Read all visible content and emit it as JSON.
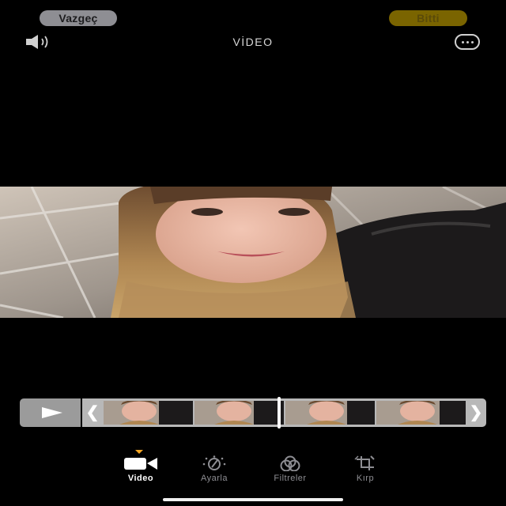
{
  "header": {
    "cancel_label": "Vazgeç",
    "done_label": "Bitti",
    "title": "VİDEO"
  },
  "icons": {
    "sound": "speaker-icon",
    "more": "more-options-icon",
    "play": "play-icon",
    "trim_left": "chevron-left-icon",
    "trim_right": "chevron-right-icon"
  },
  "timeline": {
    "left_handle": "❮",
    "right_handle": "❯",
    "frame_count": 4,
    "playhead_fraction": 0.5
  },
  "toolbar": {
    "active_tool": "video",
    "tools": [
      {
        "id": "video",
        "label": "Video",
        "icon": "video-camera-icon"
      },
      {
        "id": "adjust",
        "label": "Ayarla",
        "icon": "adjust-dial-icon"
      },
      {
        "id": "filters",
        "label": "Filtreler",
        "icon": "filters-icon"
      },
      {
        "id": "crop",
        "label": "Kırp",
        "icon": "crop-icon"
      }
    ]
  },
  "colors": {
    "background": "#000000",
    "accent": "#f5a623",
    "done_button": "#7a6400",
    "cancel_button": "#8e8e93"
  }
}
